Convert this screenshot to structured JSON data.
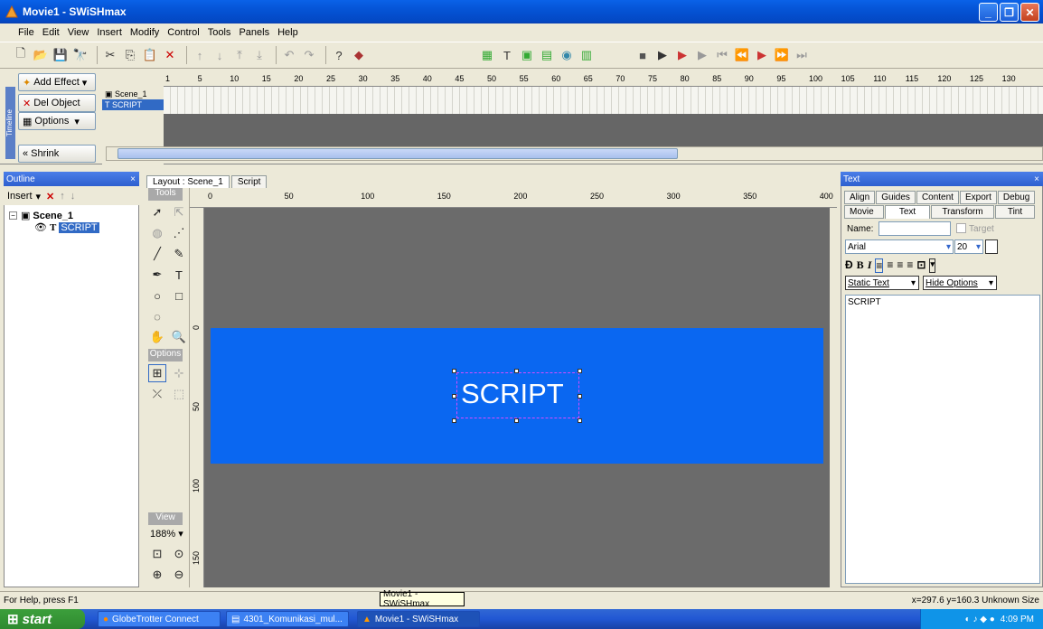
{
  "window": {
    "title": "Movie1 - SWiSHmax"
  },
  "menu": [
    "File",
    "Edit",
    "View",
    "Insert",
    "Modify",
    "Control",
    "Tools",
    "Panels",
    "Help"
  ],
  "timeline": {
    "side_label": "Timeline",
    "add_effect": "Add Effect",
    "del_object": "Del Object",
    "options": "Options",
    "shrink": "Shrink",
    "layers": [
      "Scene_1",
      "SCRIPT"
    ],
    "frame_ticks": [
      "1",
      "5",
      "10",
      "15",
      "20",
      "25",
      "30",
      "35",
      "40",
      "45",
      "50",
      "55",
      "60",
      "65",
      "70",
      "75",
      "80",
      "85",
      "90",
      "95",
      "100",
      "105",
      "110",
      "115",
      "120",
      "125",
      "130"
    ]
  },
  "outline": {
    "title": "Outline",
    "insert_label": "Insert",
    "scene": "Scene_1",
    "item": "SCRIPT"
  },
  "layout": {
    "tab_layout": "Layout : Scene_1",
    "tab_script": "Script",
    "tools_label": "Tools",
    "options_label": "Options",
    "view_label": "View",
    "zoom": "188%",
    "ruler_top": [
      "0",
      "50",
      "100",
      "150",
      "200",
      "250",
      "300",
      "350",
      "400"
    ],
    "ruler_left": [
      "0",
      "50",
      "100",
      "150"
    ],
    "stage_text": "SCRIPT"
  },
  "text_panel": {
    "title": "Text",
    "tabs_row1": [
      "Align",
      "Guides",
      "Content",
      "Export",
      "Debug"
    ],
    "tabs_row2": [
      "Movie",
      "Text",
      "Transform",
      "Tint"
    ],
    "name_label": "Name:",
    "target_label": "Target",
    "font": "Arial",
    "size": "20",
    "text_type": "Static Text",
    "hide_options": "Hide Options",
    "content": "SCRIPT"
  },
  "status": {
    "help": "For Help, press F1",
    "coords": "x=297.6 y=160.3  Unknown Size",
    "tooltip": "Movie1 - SWiSHmax"
  },
  "taskbar": {
    "start": "start",
    "items": [
      "GlobeTrotter Connect",
      "4301_Komunikasi_mul...",
      "Movie1 - SWiSHmax"
    ],
    "clock": "4:09 PM"
  },
  "colors": {
    "stage_blue": "#0a67f1",
    "title_blue": "#0554d6",
    "stage_gray": "#6b6b6b"
  }
}
